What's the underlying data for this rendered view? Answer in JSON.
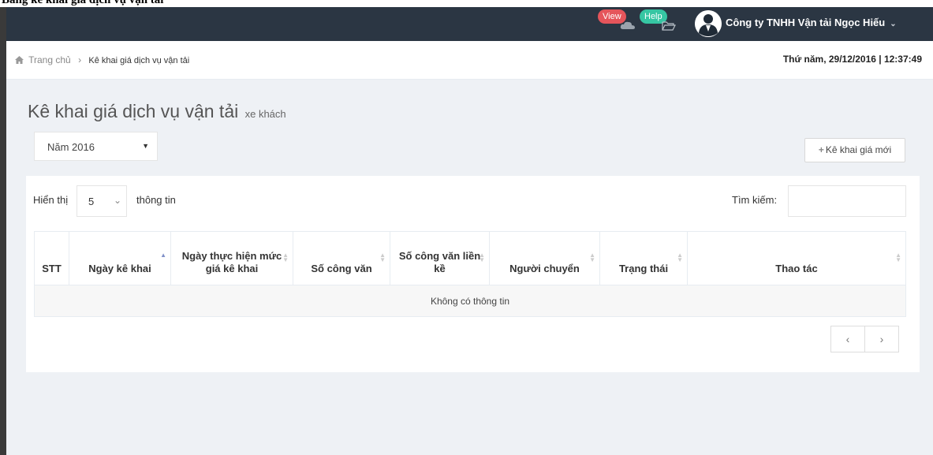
{
  "caption": "Bảng kê khai giá dịch vụ vận tải",
  "navbar": {
    "view_label": "View",
    "help_label": "Help",
    "company": "Công ty TNHH Vận tải Ngọc Hiếu",
    "colors": {
      "bg": "#2b3643",
      "view": "#e5555b",
      "help": "#36c6a3"
    }
  },
  "breadcrumb": {
    "home": "Trang chủ",
    "separator": "›",
    "current": "Kê khai giá dịch vụ vận tải"
  },
  "datetime": "Thứ năm, 29/12/2016 | 12:37:49",
  "page": {
    "title": "Kê khai giá dịch vụ vận tải",
    "subtitle": "xe khách"
  },
  "year_select": {
    "value": "Năm 2016"
  },
  "new_button": {
    "label": "Kê khai giá mới"
  },
  "table_controls": {
    "show_label": "Hiển thị",
    "length_value": "5",
    "show_suffix": "thông tin",
    "search_label": "Tìm kiếm:",
    "search_value": ""
  },
  "table": {
    "columns": [
      "STT",
      "Ngày kê khai",
      "Ngày thực hiện mức giá kê khai",
      "Số công văn",
      "Số công văn liền kề",
      "Người chuyển",
      "Trạng thái",
      "Thao tác"
    ],
    "empty_message": "Không có thông tin"
  },
  "pagination": {
    "prev": "‹",
    "next": "›"
  }
}
